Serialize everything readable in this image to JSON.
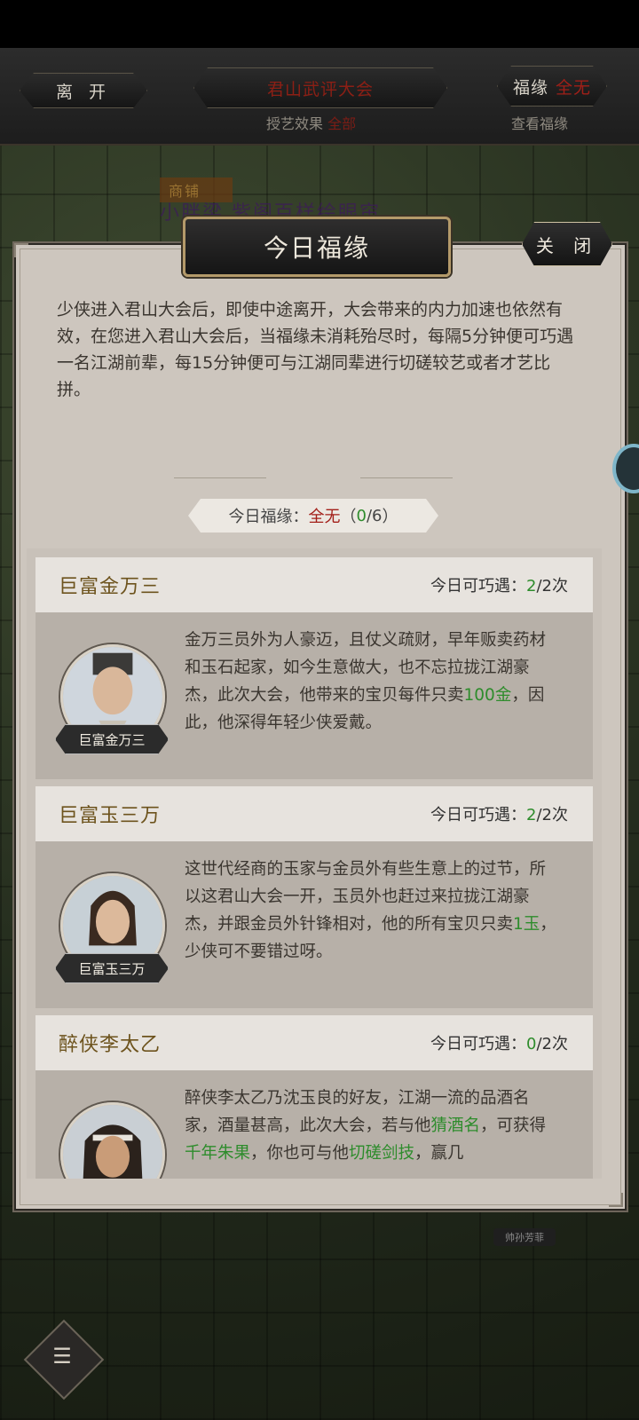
{
  "topbar": {
    "leave_label": "离 开",
    "event_title": "君山武评大会",
    "event_sub_label": "授艺效果",
    "event_sub_value": "全部",
    "fortune_label": "福缘",
    "fortune_value": "全无",
    "fortune_sub": "查看福缘"
  },
  "background": {
    "tag": "商铺",
    "banner": "小胖梁 紫阁百样绘眼帘",
    "npc_label": "帅孙芳菲"
  },
  "dialog": {
    "title": "今日福缘",
    "close_label": "关 闭",
    "intro": "少侠进入君山大会后，即使中途离开，大会带来的内力加速也依然有效，在您进入君山大会后，当福缘未消耗殆尽时，每隔5分钟便可巧遇一名江湖前辈，每15分钟便可与江湖同辈进行切磋较艺或者才艺比拼。",
    "fortune_summary": {
      "label": "今日福缘：",
      "value": "全无",
      "open": "（",
      "used": "0",
      "slash_total": "/6",
      "close": "）"
    },
    "cards": [
      {
        "name": "巨富金万三",
        "count_label": "今日可巧遇：",
        "count_used": "2",
        "count_total": "/2次",
        "tag": "巨富金万三",
        "desc_text": "金万三员外为人豪迈，且仗义疏财，早年贩卖药材和玉石起家，如今生意做大，也不忘拉拢江湖豪杰，此次大会，他带来的宝贝每件只卖",
        "desc_highlight": "100金",
        "desc_tail": "，因此，他深得年轻少侠爱戴。"
      },
      {
        "name": "巨富玉三万",
        "count_label": "今日可巧遇：",
        "count_used": "2",
        "count_total": "/2次",
        "tag": "巨富玉三万",
        "desc_text": "这世代经商的玉家与金员外有些生意上的过节，所以这君山大会一开，玉员外也赶过来拉拢江湖豪杰，并跟金员外针锋相对，他的所有宝贝只卖",
        "desc_highlight": "1玉",
        "desc_tail": "，少侠可不要错过呀。"
      },
      {
        "name": "醉侠李太乙",
        "count_label": "今日可巧遇：",
        "count_used": "0",
        "count_total": "/2次",
        "desc_text": "醉侠李太乙乃沈玉良的好友，江湖一流的品酒名家，酒量甚高，此次大会，若与他",
        "desc_highlight": "猜酒名",
        "desc_mid": "，可获得",
        "desc_highlight2": "千年朱果",
        "desc_mid2": "，你也可与他",
        "desc_highlight3": "切磋剑技",
        "desc_tail": "，赢几"
      }
    ]
  },
  "colors": {
    "accent_red": "#a21d17",
    "accent_green": "#2e8c2c",
    "card_name": "#6d531d",
    "panel": "#cdc6be"
  }
}
